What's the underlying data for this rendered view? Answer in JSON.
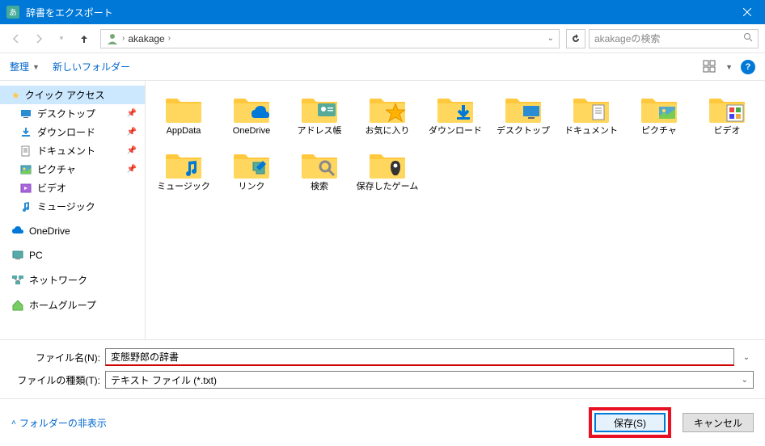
{
  "title": "辞書をエクスポート",
  "breadcrumb": {
    "user": "akakage"
  },
  "search": {
    "placeholder": "akakageの検索"
  },
  "toolbar": {
    "organize": "整理",
    "newfolder": "新しいフォルダー"
  },
  "sidebar": {
    "quick": "クイック アクセス",
    "items": [
      {
        "label": "デスクトップ",
        "icon": "desktop",
        "pinned": true
      },
      {
        "label": "ダウンロード",
        "icon": "download",
        "pinned": true
      },
      {
        "label": "ドキュメント",
        "icon": "document",
        "pinned": true
      },
      {
        "label": "ピクチャ",
        "icon": "picture",
        "pinned": true
      },
      {
        "label": "ビデオ",
        "icon": "video",
        "pinned": false
      },
      {
        "label": "ミュージック",
        "icon": "music",
        "pinned": false
      }
    ],
    "onedrive": "OneDrive",
    "pc": "PC",
    "network": "ネットワーク",
    "homegroup": "ホームグループ"
  },
  "folders": [
    {
      "label": "AppData",
      "overlay": "none"
    },
    {
      "label": "OneDrive",
      "overlay": "cloud"
    },
    {
      "label": "アドレス帳",
      "overlay": "contact"
    },
    {
      "label": "お気に入り",
      "overlay": "star"
    },
    {
      "label": "ダウンロード",
      "overlay": "download"
    },
    {
      "label": "デスクトップ",
      "overlay": "desktop"
    },
    {
      "label": "ドキュメント",
      "overlay": "document"
    },
    {
      "label": "ピクチャ",
      "overlay": "picture"
    },
    {
      "label": "ビデオ",
      "overlay": "video"
    },
    {
      "label": "ミュージック",
      "overlay": "music"
    },
    {
      "label": "リンク",
      "overlay": "link"
    },
    {
      "label": "検索",
      "overlay": "search"
    },
    {
      "label": "保存したゲーム",
      "overlay": "game"
    }
  ],
  "form": {
    "filename_label": "ファイル名(N):",
    "filename_value": "変態野郎の辞書",
    "filetype_label": "ファイルの種類(T):",
    "filetype_value": "テキスト ファイル (*.txt)"
  },
  "footer": {
    "hide_folders": "フォルダーの非表示",
    "save": "保存(S)",
    "cancel": "キャンセル"
  }
}
